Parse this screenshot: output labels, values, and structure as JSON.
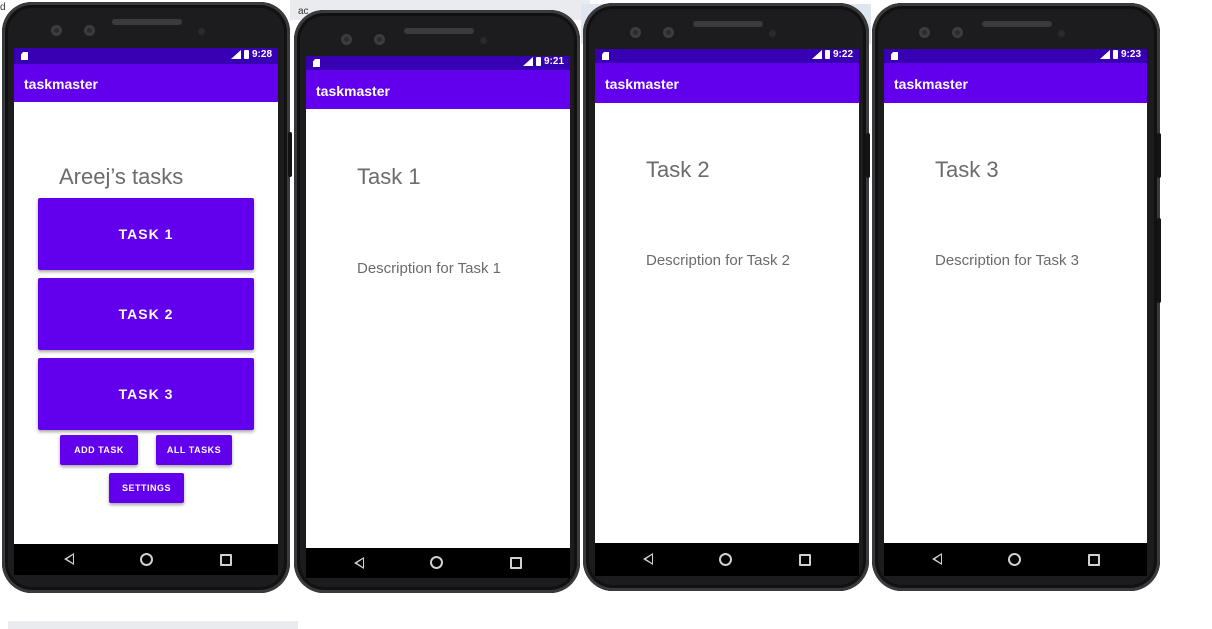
{
  "app": {
    "name": "taskmaster"
  },
  "screens": [
    {
      "time": "9:28",
      "heading": "Areej’s tasks",
      "buttons": {
        "task1": "TASK 1",
        "task2": "TASK 2",
        "task3": "TASK 3",
        "add_task": "ADD TASK",
        "all_tasks": "ALL TASKS",
        "settings": "SETTINGS"
      }
    },
    {
      "time": "9:21",
      "title": "Task 1",
      "description": "Description for Task 1"
    },
    {
      "time": "9:22",
      "title": "Task 2",
      "description": "Description for Task 2"
    },
    {
      "time": "9:23",
      "title": "Task 3",
      "description": "Description for Task 3"
    }
  ],
  "background_fragments": {
    "left_edge": "d",
    "top_text": "ac"
  },
  "colors": {
    "primary": "#6200ee",
    "primary_dark": "#3700b3",
    "text_secondary": "#6b6b6b"
  }
}
